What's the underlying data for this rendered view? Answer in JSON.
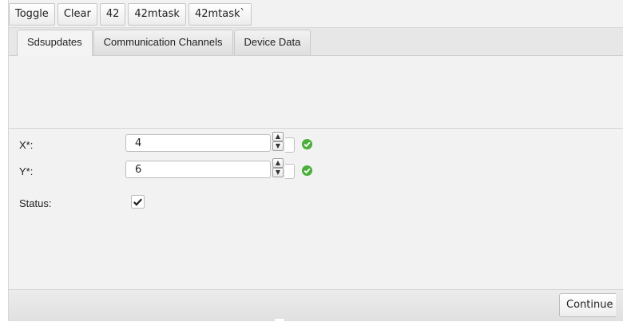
{
  "toolbar": {
    "buttons": [
      "Toggle",
      "Clear",
      "42",
      "42mtask",
      "42mtask`"
    ]
  },
  "tabs": [
    {
      "label": "Sdsupdates",
      "active": true
    },
    {
      "label": "Communication Channels",
      "active": false
    },
    {
      "label": "Device Data",
      "active": false
    }
  ],
  "form": {
    "x": {
      "label": "X*:",
      "value": "4",
      "valid": true
    },
    "y": {
      "label": "Y*:",
      "value": "6",
      "valid": true
    },
    "status": {
      "label": "Status:",
      "checked": true
    }
  },
  "footer": {
    "continue_label": "Continue"
  },
  "colors": {
    "valid_green": "#4caf3c",
    "panel_bg": "#f2f2f2"
  },
  "icons": {
    "valid": "check-circle-icon",
    "spin_up": "chevron-up-icon",
    "spin_down": "chevron-down-icon",
    "checkbox": "checkmark-icon"
  }
}
